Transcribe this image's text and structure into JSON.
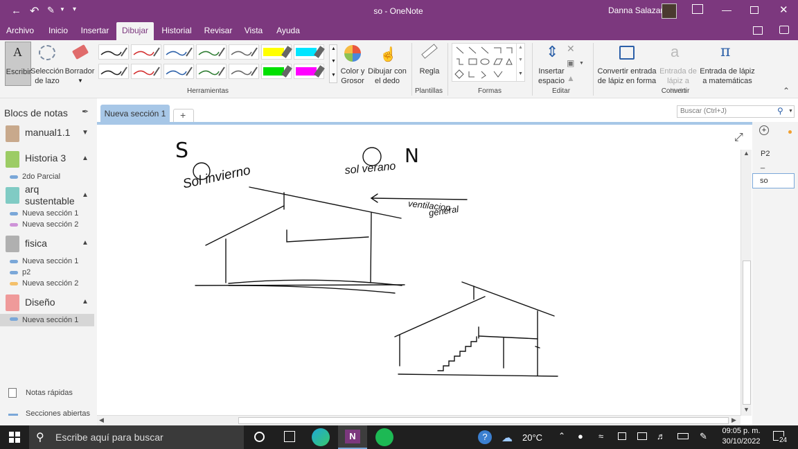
{
  "window": {
    "title": "so  -  OneNote",
    "user": "Danna Salazar"
  },
  "ribbon_tabs": [
    "Archivo",
    "Inicio",
    "Insertar",
    "Dibujar",
    "Historial",
    "Revisar",
    "Vista",
    "Ayuda"
  ],
  "active_tab": "Dibujar",
  "ribbon": {
    "tools": {
      "write": "Escribir",
      "lasso_1": "Selección",
      "lasso_2": "de lazo",
      "eraser": "Borrador"
    },
    "color_1": "Color y",
    "color_2": "Grosor",
    "finger_1": "Dibujar con",
    "finger_2": "el dedo",
    "ruler": "Regla",
    "insert_space_1": "Insertar",
    "insert_space_2": "espacio",
    "ink_shape_1": "Convertir entrada",
    "ink_shape_2": "de lápiz en forma",
    "ink_text_1": "Entrada de",
    "ink_text_2": "lápiz a texto",
    "ink_math_1": "Entrada de lápiz",
    "ink_math_2": "a matemáticas",
    "groups": {
      "tools": "Herramientas",
      "templates": "Plantillas",
      "shapes": "Formas",
      "edit": "Editar",
      "convert": "Convertir"
    },
    "pen_colors": [
      "#222222",
      "#d32f2f",
      "#2b5fa8",
      "#2e7d32",
      "#666666",
      "#ffff00",
      "#00e5ff",
      "#222222",
      "#d32f2f",
      "#2b5fa8",
      "#2e7d32",
      "#666666",
      "#00e000",
      "#ff00ff"
    ]
  },
  "sidebar": {
    "header": "Blocs de notas",
    "notebooks": [
      {
        "name": "manual1.1",
        "color": "#c8a98c",
        "sections": []
      },
      {
        "name": "Historia 3",
        "color": "#9ccc65",
        "sections": [
          {
            "name": "2do Parcial",
            "color": "#7aa7d8"
          }
        ]
      },
      {
        "name_1": "arq",
        "name_2": "sustentable",
        "color": "#80cbc4",
        "sections": [
          {
            "name": "Nueva sección 1",
            "color": "#7aa7d8"
          },
          {
            "name": "Nueva sección 2",
            "color": "#ce93d8"
          }
        ]
      },
      {
        "name": "fisica",
        "color": "#b0b0b0",
        "sections": [
          {
            "name": "Nueva sección 1",
            "color": "#7aa7d8"
          },
          {
            "name": "p2",
            "color": "#7aa7d8"
          },
          {
            "name": "Nueva sección 2",
            "color": "#f4c06a"
          }
        ]
      },
      {
        "name": "Diseño",
        "color": "#ef9a9a",
        "sections": [
          {
            "name": "Nueva sección 1",
            "color": "#7aa7d8"
          }
        ]
      }
    ],
    "quick_notes": "Notas rápidas",
    "open_sections": "Secciones abiertas"
  },
  "section_tabs": {
    "active": "Nueva sección 1",
    "add": "+"
  },
  "search": {
    "placeholder": "Buscar (Ctrl+J)"
  },
  "pages": {
    "items": [
      "P2",
      "_",
      "so"
    ],
    "selected": "so"
  },
  "ink_text": {
    "s": "S",
    "n": "N",
    "sol_invierno": "Sol invierno",
    "sol_verano": "sol verano",
    "ventilacion": "ventilacion",
    "general": "general"
  },
  "taskbar": {
    "search_placeholder": "Escribe aquí para buscar",
    "weather": "20°C",
    "time": "09:05 p. m.",
    "date": "30/10/2022",
    "notifications": "24"
  }
}
